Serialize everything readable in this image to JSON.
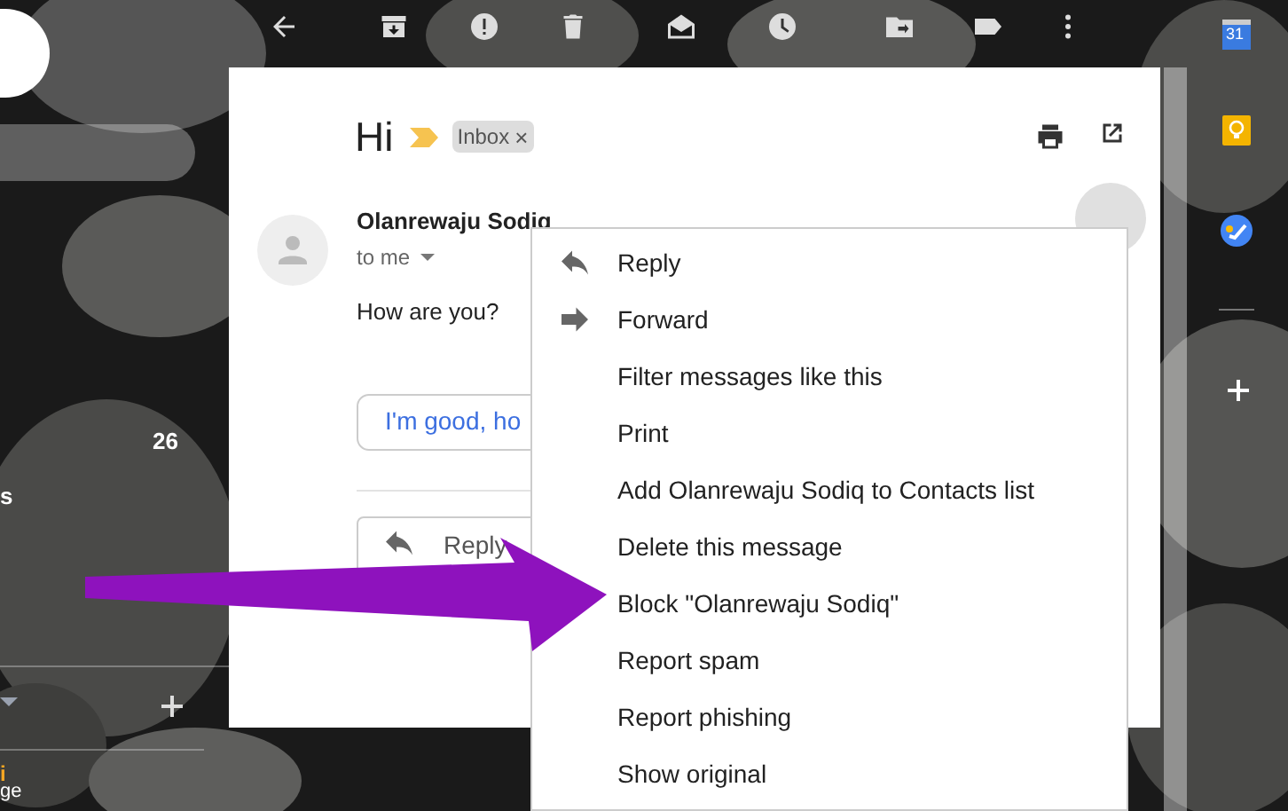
{
  "left_panel": {
    "count": "26",
    "letter": "s",
    "bottom_texts": [
      "i",
      "ge"
    ]
  },
  "email": {
    "subject": "Hi",
    "label": {
      "text": "Inbox",
      "remove": "×"
    },
    "sender": "Olanrewaju Sodiq",
    "recipient": "to me",
    "body": "How are you?",
    "smart_reply": "I'm good, ho",
    "reply_button": "Reply"
  },
  "menu": {
    "items": [
      {
        "label": "Reply",
        "kind": "reply"
      },
      {
        "label": "Forward",
        "kind": "forward"
      },
      {
        "label": "Filter messages like this",
        "kind": "plain"
      },
      {
        "label": "Print",
        "kind": "plain"
      },
      {
        "label": "Add Olanrewaju Sodiq to Contacts list",
        "kind": "plain"
      },
      {
        "label": "Delete this message",
        "kind": "plain"
      },
      {
        "label": "Block \"Olanrewaju Sodiq\"",
        "kind": "plain"
      },
      {
        "label": "Report spam",
        "kind": "plain"
      },
      {
        "label": "Report phishing",
        "kind": "plain"
      },
      {
        "label": "Show original",
        "kind": "plain"
      }
    ]
  },
  "side_apps": {
    "calendar_day": "31"
  }
}
